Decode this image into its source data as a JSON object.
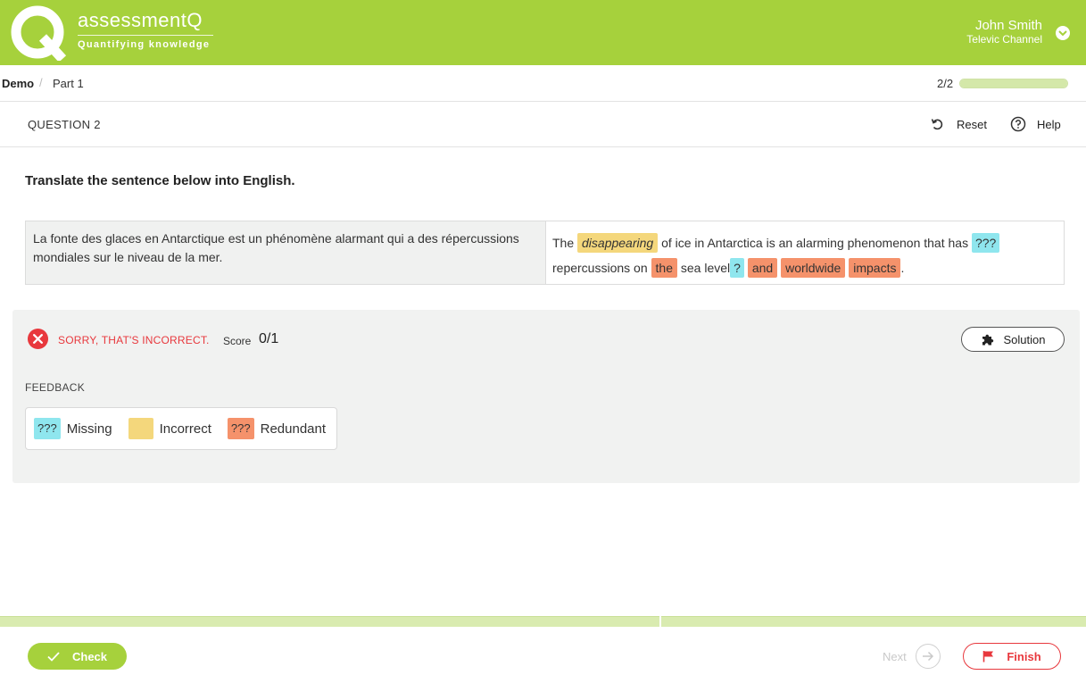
{
  "header": {
    "brand_name": "assessmentQ",
    "brand_tagline": "Quantifying knowledge",
    "user_name": "John Smith",
    "user_org": "Televic Channel",
    "accent_color": "#a6d13c"
  },
  "breadcrumb": {
    "items": [
      "Demo",
      "Part 1"
    ],
    "separator": "/"
  },
  "progress": {
    "text": "2/2",
    "fraction": 1.0
  },
  "question": {
    "label": "QUESTION 2",
    "reset_label": "Reset",
    "help_label": "Help",
    "instruction": "Translate the sentence below into English.",
    "source_text": "La fonte des glaces en Antarctique est un phénomène alarmant qui a des répercussions mondiales sur le niveau de la mer.",
    "answer_tokens": [
      {
        "text": "The",
        "status": "plain"
      },
      {
        "text": "disappearing",
        "status": "incorrect"
      },
      {
        "text": "of ice in Antarctica is an alarming phenomenon that has",
        "status": "plain"
      },
      {
        "text": "???",
        "status": "missing"
      },
      {
        "text": "repercussions on",
        "status": "plain"
      },
      {
        "text": "the",
        "status": "redundant"
      },
      {
        "text": "sea level",
        "status": "plain"
      },
      {
        "text": "?",
        "status": "missing"
      },
      {
        "text": "and",
        "status": "redundant"
      },
      {
        "text": "worldwide",
        "status": "redundant"
      },
      {
        "text": "impacts",
        "status": "redundant"
      },
      {
        "text": ".",
        "status": "plain"
      }
    ]
  },
  "result": {
    "status_text": "SORRY, THAT'S INCORRECT.",
    "score_label": "Score",
    "score_value": "0/1",
    "solution_label": "Solution",
    "feedback_label": "FEEDBACK",
    "legend": {
      "missing_swatch": "???",
      "missing_label": "Missing",
      "incorrect_label": "Incorrect",
      "redundant_swatch": "???",
      "redundant_label": "Redundant"
    },
    "colors": {
      "missing": "#8fe6ee",
      "incorrect": "#f4d77c",
      "redundant": "#f5926b",
      "error": "#e8383d"
    }
  },
  "footer": {
    "check_label": "Check",
    "next_label": "Next",
    "finish_label": "Finish"
  }
}
